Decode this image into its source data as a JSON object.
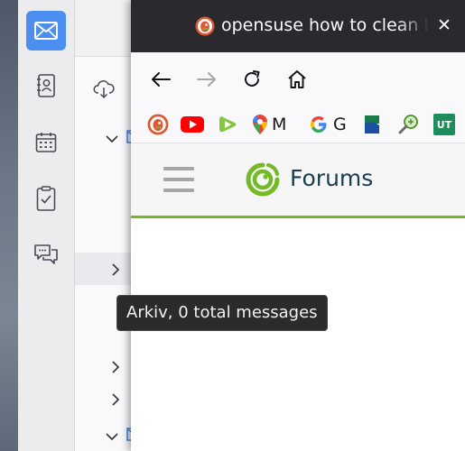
{
  "firefox": {
    "tab_title": "opensuse how to clean b",
    "close_label": "✕",
    "bookmarks": [
      {
        "name": "duckduckgo",
        "letter": ""
      },
      {
        "name": "youtube",
        "letter": ""
      },
      {
        "name": "rumble",
        "letter": ""
      },
      {
        "name": "google-maps",
        "letter": "M"
      },
      {
        "name": "google",
        "letter": "G"
      },
      {
        "name": "kayak",
        "letter": ""
      },
      {
        "name": "search-tool",
        "letter": ""
      },
      {
        "name": "ut",
        "letter": "UT"
      }
    ],
    "site": {
      "title": "Forums",
      "accent_color": "#73ba25"
    }
  },
  "thunderbird": {
    "spaces": [
      "mail-icon",
      "address-book-icon",
      "calendar-icon",
      "tasks-icon",
      "chat-icon"
    ],
    "tooltip": "Arkiv, 0 total messages"
  }
}
